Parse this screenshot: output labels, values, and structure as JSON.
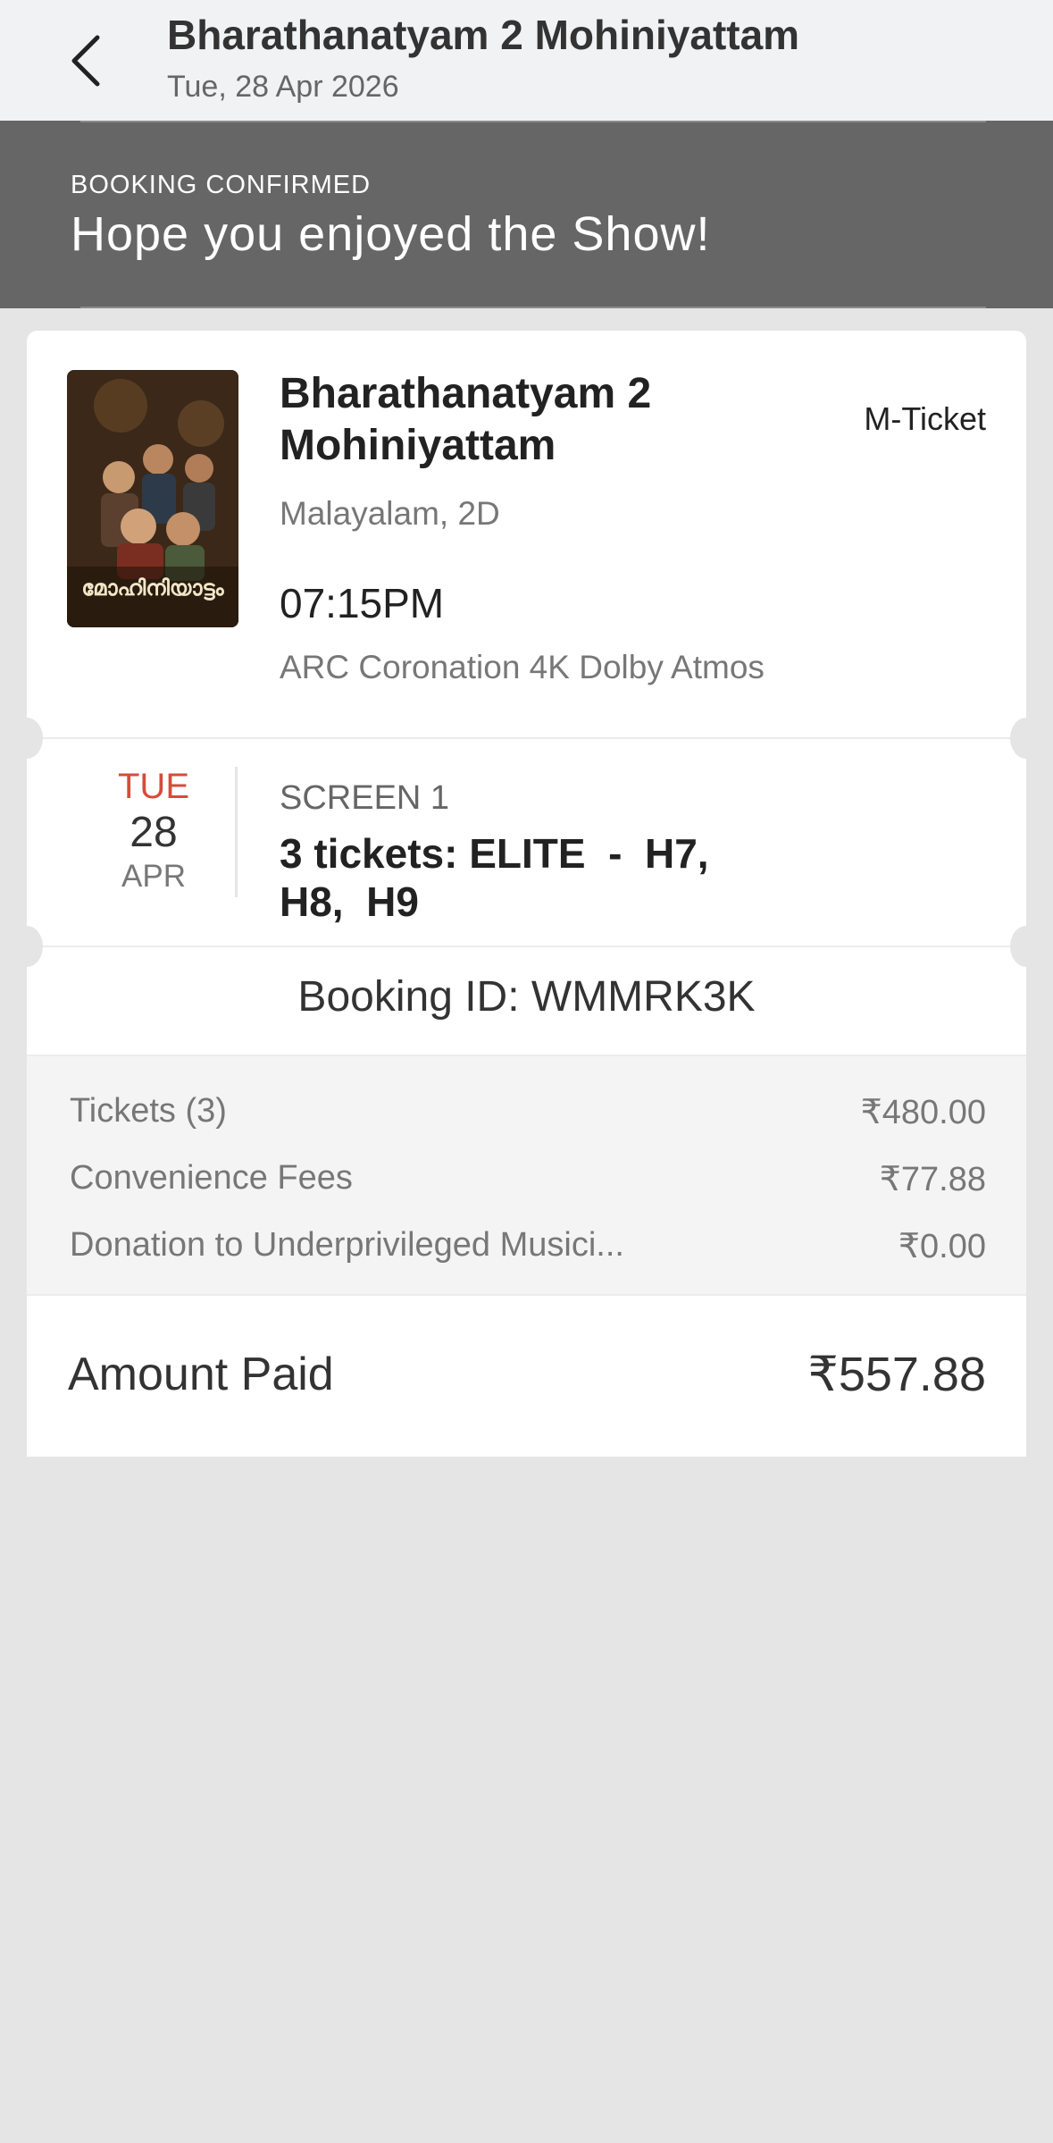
{
  "header": {
    "title": "Bharathanatyam 2 Mohiniyattam",
    "subtitle": "Tue, 28 Apr 2026"
  },
  "banner": {
    "kicker": "BOOKING CONFIRMED",
    "title": "Hope you enjoyed the Show!"
  },
  "ticket": {
    "movie_title": "Bharathanatyam 2 Mohiniyattam",
    "ticket_type": "M-Ticket",
    "language_format": "Malayalam, 2D",
    "showtime": "07:15PM",
    "cinema": "ARC Coronation 4K Dolby Atmos",
    "poster_text": "മോഹിനിയാട്ടം",
    "date": {
      "day_of_week": "TUE",
      "day": "28",
      "month": "APR"
    },
    "screen": "SCREEN 1",
    "seats": "3 tickets: ELITE  -  H7,\nH8,  H9",
    "booking_id": "Booking ID: WMMRK3K"
  },
  "fees": [
    {
      "label": "Tickets (3)",
      "value": "₹480.00"
    },
    {
      "label": "Convenience Fees",
      "value": "₹77.88"
    },
    {
      "label": "Donation to Underprivileged Musici...",
      "value": "₹0.00"
    }
  ],
  "amount_paid": {
    "label": "Amount Paid",
    "value": "₹557.88"
  },
  "colors": {
    "banner_bg": "#666666",
    "accent_red": "#d64b3b",
    "page_bg": "#e5e5e5"
  }
}
